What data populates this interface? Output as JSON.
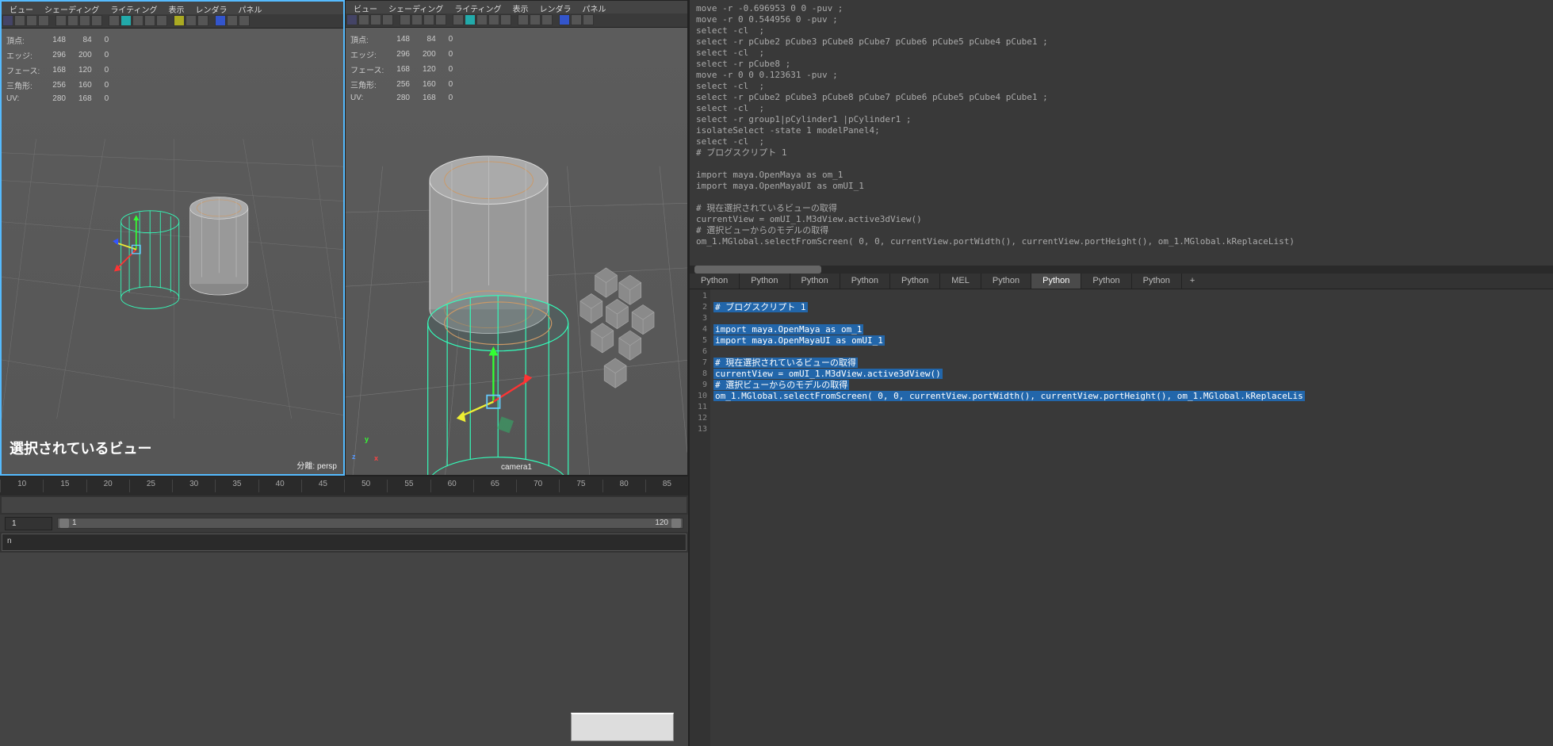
{
  "viewportMenu": {
    "view": "ビュー",
    "shading": "シェーディング",
    "lighting": "ライティング",
    "show": "表示",
    "renderer": "レンダラ",
    "panels": "パネル"
  },
  "stats": {
    "labels": {
      "verts": "頂点:",
      "edges": "エッジ:",
      "faces": "フェース:",
      "tris": "三角形:",
      "uvs": "UV:"
    },
    "vp1": {
      "verts": [
        "148",
        "84",
        "0"
      ],
      "edges": [
        "296",
        "200",
        "0"
      ],
      "faces": [
        "168",
        "120",
        "0"
      ],
      "tris": [
        "256",
        "160",
        "0"
      ],
      "uvs": [
        "280",
        "168",
        "0"
      ]
    },
    "vp2": {
      "verts": [
        "148",
        "84",
        "0"
      ],
      "edges": [
        "296",
        "200",
        "0"
      ],
      "faces": [
        "168",
        "120",
        "0"
      ],
      "tris": [
        "256",
        "160",
        "0"
      ],
      "uvs": [
        "280",
        "168",
        "0"
      ]
    }
  },
  "vp1": {
    "overlay": "選択されているビュー",
    "dist": "分離: persp"
  },
  "vp2": {
    "cam": "camera1"
  },
  "timeline": {
    "ticks": [
      "10",
      "15",
      "20",
      "25",
      "30",
      "35",
      "40",
      "45",
      "50",
      "55",
      "60",
      "65",
      "70",
      "75",
      "80",
      "85"
    ],
    "startFrame": "1",
    "rangeStart": "1",
    "rangeEnd": "120"
  },
  "cmdline": {
    "prefix": "n"
  },
  "scriptOutput": "move -r -0.696953 0 0 -puv ;\nmove -r 0 0.544956 0 -puv ;\nselect -cl  ;\nselect -r pCube2 pCube3 pCube8 pCube7 pCube6 pCube5 pCube4 pCube1 ;\nselect -cl  ;\nselect -r pCube8 ;\nmove -r 0 0 0.123631 -puv ;\nselect -cl  ;\nselect -r pCube2 pCube3 pCube8 pCube7 pCube6 pCube5 pCube4 pCube1 ;\nselect -cl  ;\nselect -r group1|pCylinder1 |pCylinder1 ;\nisolateSelect -state 1 modelPanel4;\nselect -cl  ;\n# ブログスクリプト 1\n\nimport maya.OpenMaya as om_1\nimport maya.OpenMayaUI as omUI_1\n\n# 現在選択されているビューの取得\ncurrentView = omUI_1.M3dView.active3dView()\n# 選択ビューからのモデルの取得\nom_1.MGlobal.selectFromScreen( 0, 0, currentView.portWidth(), currentView.portHeight(), om_1.MGlobal.kReplaceList)",
  "scriptTabs": {
    "python": "Python",
    "mel": "MEL",
    "add": "+"
  },
  "scriptCode": {
    "l1": "# ブログスクリプト 1",
    "l2": "",
    "l3": "import maya.OpenMaya as om_1",
    "l4": "import maya.OpenMayaUI as omUI_1",
    "l5": "",
    "l6": "# 現在選択されているビューの取得",
    "l7": "currentView = omUI_1.M3dView.active3dView()",
    "l8": "# 選択ビューからのモデルの取得",
    "l9": "om_1.MGlobal.selectFromScreen( 0, 0, currentView.portWidth(), currentView.portHeight(), om_1.MGlobal.kReplaceLis",
    "lineNums": [
      "1",
      "2",
      "3",
      "4",
      "5",
      "6",
      "7",
      "8",
      "9",
      "10",
      "11",
      "12",
      "13"
    ]
  },
  "axes": {
    "x": "x",
    "y": "y",
    "z": "z"
  }
}
